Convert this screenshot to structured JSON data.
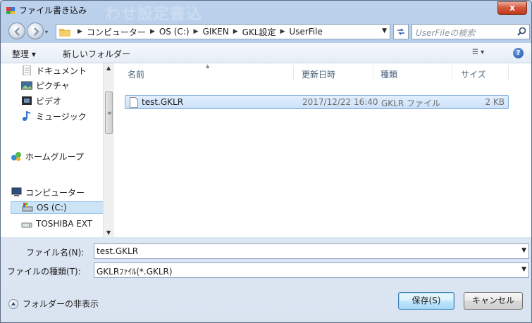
{
  "window": {
    "title": "ファイル書き込み",
    "ghost_title": "わせ設定書込",
    "close_label": "x"
  },
  "nav": {
    "hist_arrow": "▾",
    "breadcrumbs": [
      "コンピューター",
      "OS (C:)",
      "GIKEN",
      "GKL設定",
      "UserFile"
    ],
    "search_placeholder": "UserFileの検索"
  },
  "toolbar": {
    "organize_label": "整理 ▾",
    "new_folder_label": "新しいフォルダー",
    "help_label": "?"
  },
  "sidebar": {
    "items": [
      {
        "label": "ドキュメント",
        "icon": "document-icon"
      },
      {
        "label": "ピクチャ",
        "icon": "picture-icon"
      },
      {
        "label": "ビデオ",
        "icon": "video-icon"
      },
      {
        "label": "ミュージック",
        "icon": "music-icon"
      },
      {
        "label": "ホームグループ",
        "icon": "homegroup-icon"
      },
      {
        "label": "コンピューター",
        "icon": "computer-icon"
      },
      {
        "label": "OS (C:)",
        "icon": "drive-icon"
      },
      {
        "label": "TOSHIBA EXT",
        "icon": "external-drive-icon"
      }
    ],
    "selected": "OS (C:)"
  },
  "file_list": {
    "columns": [
      "名前",
      "更新日時",
      "種類",
      "サイズ"
    ],
    "rows": [
      {
        "name": "test.GKLR",
        "modified": "2017/12/22 16:40",
        "type": "GKLR ファイル",
        "size": "2 KB"
      }
    ]
  },
  "form": {
    "filename_label": "ファイル名(N):",
    "filename_value": "test.GKLR",
    "filetype_label": "ファイルの種類(T):",
    "filetype_value": "GKLRﾌｧｲﾙ(*.GKLR)",
    "hide_folders_label": "フォルダーの非表示",
    "save_label": "保存(S)",
    "cancel_label": "キャンセル"
  },
  "colors": {
    "accent": "#3c7fb1",
    "selection": "#cde4f7",
    "close": "#c3381b"
  }
}
